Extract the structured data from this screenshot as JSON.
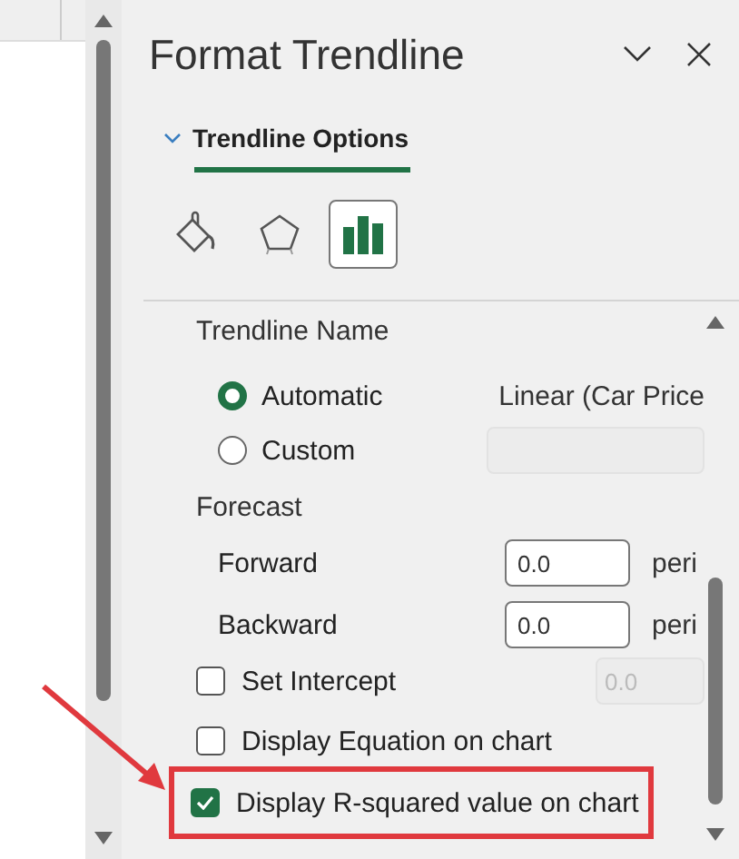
{
  "window": {
    "title": "Format Trendline"
  },
  "section": {
    "title": "Trendline Options",
    "expanded": true
  },
  "category_tabs": [
    {
      "kind": "fill",
      "selected": false
    },
    {
      "kind": "effects",
      "selected": false
    },
    {
      "kind": "options",
      "selected": true
    }
  ],
  "trendline_name": {
    "heading": "Trendline Name",
    "choices": [
      {
        "label": "Automatic",
        "selected": true,
        "value": "Linear (Car Price"
      },
      {
        "label": "Custom",
        "selected": false
      }
    ]
  },
  "forecast": {
    "heading": "Forecast",
    "fields": [
      {
        "label": "Forward",
        "value": "0.0",
        "unit": "peri"
      },
      {
        "label": "Backward",
        "value": "0.0",
        "unit": "peri"
      }
    ]
  },
  "options": [
    {
      "label": "Set Intercept",
      "checked": false,
      "field_value": "0.0"
    },
    {
      "label": "Display Equation on chart",
      "checked": false
    },
    {
      "label": "Display R-squared value on chart",
      "checked": true,
      "highlighted": true
    }
  ]
}
